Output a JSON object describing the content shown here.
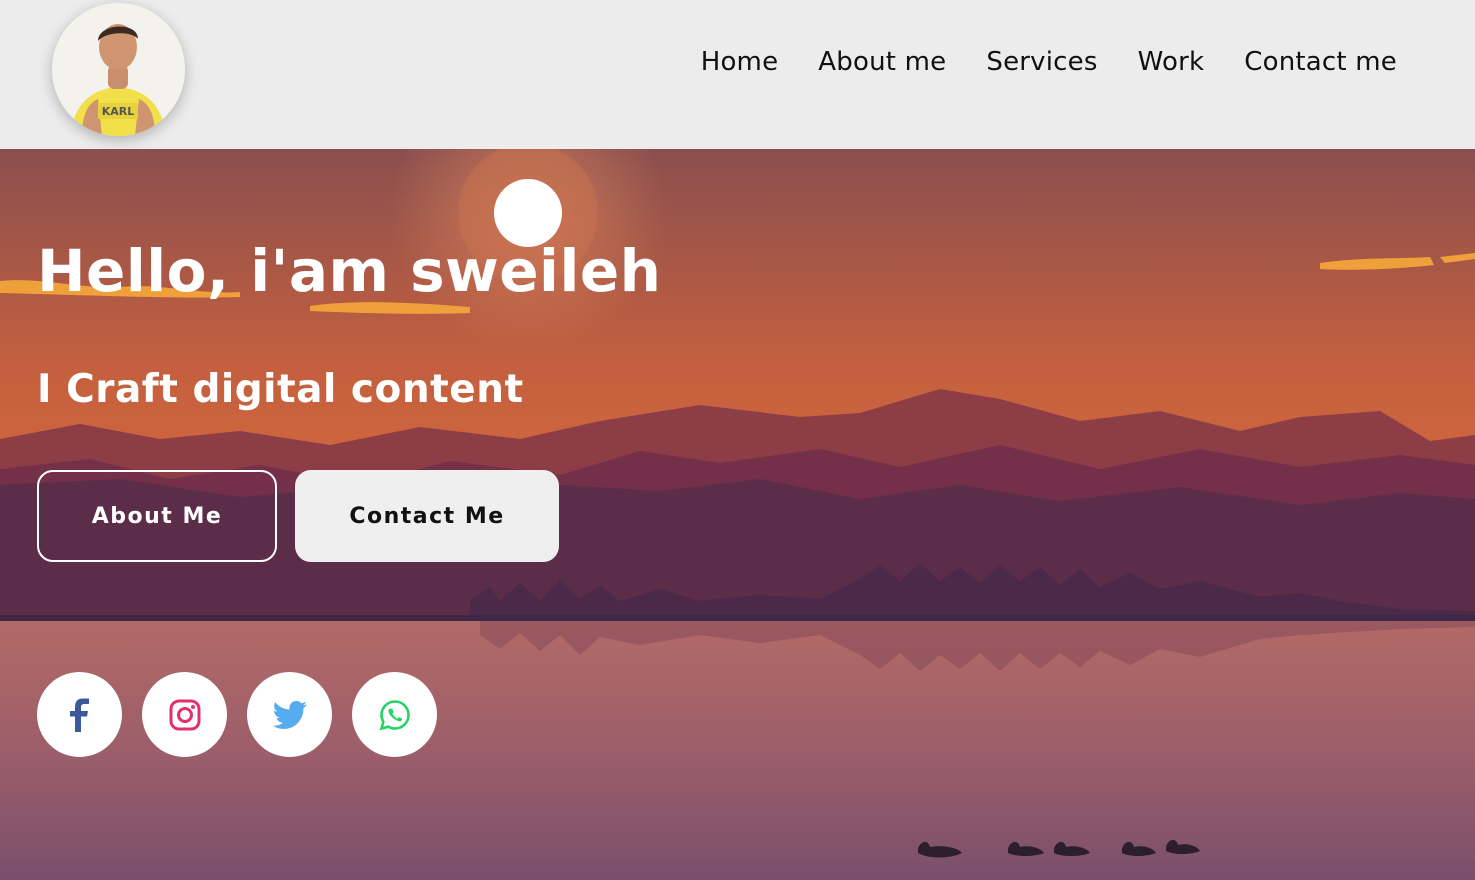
{
  "header": {
    "nav": [
      {
        "label": "Home"
      },
      {
        "label": "About me"
      },
      {
        "label": "Services"
      },
      {
        "label": "Work"
      },
      {
        "label": "Contact me"
      }
    ]
  },
  "hero": {
    "title": "Hello, i'am sweileh",
    "subtitle": "I Craft digital content",
    "buttons": {
      "about_label": "About Me",
      "contact_label": "Contact Me"
    }
  },
  "socials": [
    {
      "icon": "facebook-icon",
      "color": "#3b5998"
    },
    {
      "icon": "instagram-icon",
      "color": "#e1306c"
    },
    {
      "icon": "twitter-icon",
      "color": "#55acee"
    },
    {
      "icon": "whatsapp-icon",
      "color": "#25d366"
    }
  ],
  "colors": {
    "header_bg": "#ececec",
    "sky_top": "#8a4f4e",
    "sky_mid": "#d4683b",
    "mountain_dark": "#5a2f48",
    "lake": "#a8626a"
  }
}
